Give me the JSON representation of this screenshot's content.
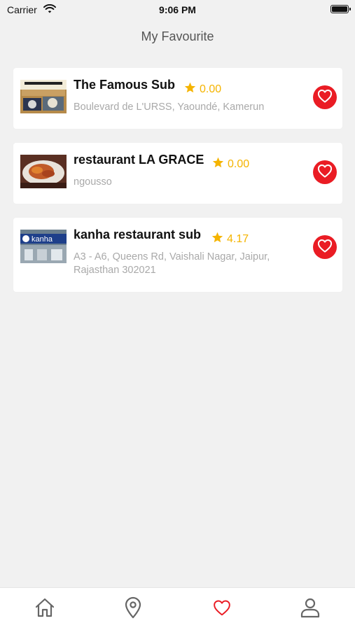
{
  "status_bar": {
    "carrier": "Carrier",
    "time": "9:06 PM"
  },
  "header": {
    "title": "My Favourite"
  },
  "colors": {
    "accent": "#ea1c24",
    "star": "#f5b400",
    "background": "#f1f1f1"
  },
  "restaurants": [
    {
      "name": "The Famous Sub",
      "rating": "0.00",
      "address": "Boulevard de L'URSS, Yaoundé, Kamerun",
      "favourite": true
    },
    {
      "name": "restaurant LA GRACE",
      "rating": "0.00",
      "address": "ngousso",
      "favourite": true
    },
    {
      "name": "kanha restaurant sub",
      "rating": "4.17",
      "address": "A3 - A6, Queens Rd, Vaishali Nagar, Jaipur, Rajasthan 302021",
      "favourite": true
    }
  ],
  "tab_bar": {
    "items": [
      {
        "icon": "home-icon",
        "active": false
      },
      {
        "icon": "location-pin-icon",
        "active": false
      },
      {
        "icon": "heart-icon",
        "active": true
      },
      {
        "icon": "user-icon",
        "active": false
      }
    ]
  }
}
